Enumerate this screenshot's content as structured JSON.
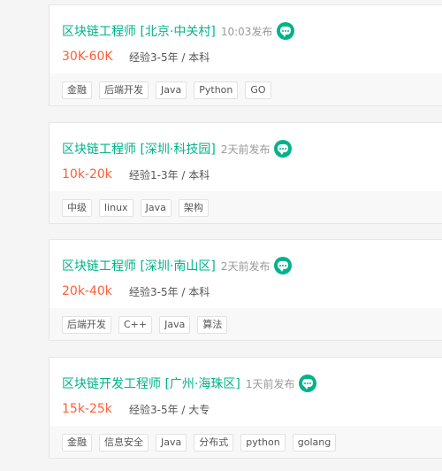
{
  "jobs": [
    {
      "title": "区块链工程师 [北京·中关村]",
      "publish_time": "10:03发布",
      "salary": "30K-60K",
      "requirement": "经验3-5年 / 本科",
      "tags": [
        "金融",
        "后端开发",
        "Java",
        "Python",
        "GO"
      ]
    },
    {
      "title": "区块链工程师 [深圳·科技园]",
      "publish_time": "2天前发布",
      "salary": "10k-20k",
      "requirement": "经验1-3年 / 本科",
      "tags": [
        "中级",
        "linux",
        "Java",
        "架构"
      ]
    },
    {
      "title": "区块链工程师 [深圳·南山区]",
      "publish_time": "2天前发布",
      "salary": "20k-40k",
      "requirement": "经验3-5年 / 本科",
      "tags": [
        "后端开发",
        "C++",
        "Java",
        "算法"
      ]
    },
    {
      "title": "区块链开发工程师 [广州·海珠区]",
      "publish_time": "1天前发布",
      "salary": "15k-25k",
      "requirement": "经验3-5年 / 大专",
      "tags": [
        "金融",
        "信息安全",
        "Java",
        "分布式",
        "python",
        "golang"
      ]
    }
  ],
  "icons": {
    "chat": "chat-bubble-icon"
  },
  "colors": {
    "title": "#00b38a",
    "salary": "#fd5f39",
    "chat_icon": "#00b38a"
  }
}
